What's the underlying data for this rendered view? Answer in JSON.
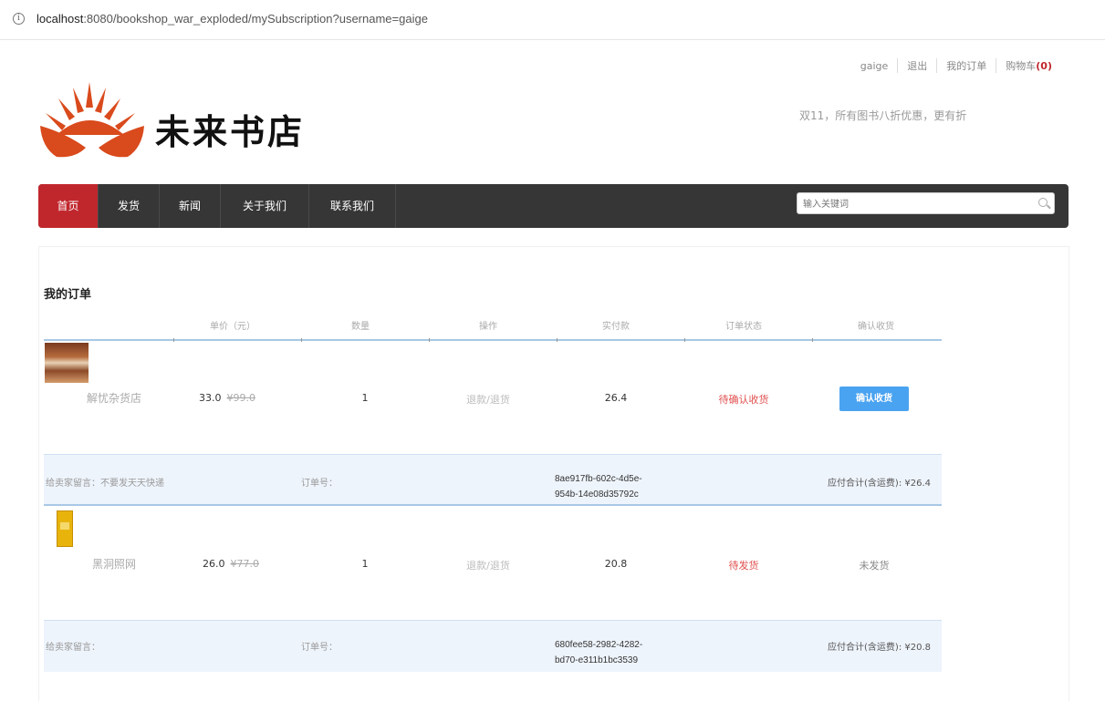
{
  "browser": {
    "url_host": "localhost",
    "url_rest": ":8080/bookshop_war_exploded/mySubscription?username=gaige"
  },
  "header": {
    "user_links": [
      "gaige",
      "退出",
      "我的订单",
      "购物车"
    ],
    "cart_count": "(0)",
    "promo": "双11，所有图书八折优惠，更有折",
    "logo_text": "未来书店"
  },
  "nav": {
    "items": [
      "首页",
      "发货",
      "新闻",
      "关于我们",
      "联系我们"
    ],
    "search_placeholder": "输入关键词"
  },
  "orders": {
    "title": "我的订单",
    "columns": [
      "单价（元）",
      "数量",
      "操作",
      "实付款",
      "订单状态",
      "确认收货"
    ],
    "rows": [
      {
        "name": "解忧杂货店",
        "price": "33.0",
        "old_price": "¥99.0",
        "qty": "1",
        "action": "退款/退货",
        "paid": "26.4",
        "status": "待确认收货",
        "confirm": "确认收货",
        "remark": "给卖家留言：不要发天天快递",
        "order_label": "订单号：",
        "order_id_1": "8ae917fb-602c-4d5e-",
        "order_id_2": "954b-14e08d35792c",
        "total": "应付合计(含运费): ¥26.4"
      },
      {
        "name": "黑洞照网",
        "price": "26.0",
        "old_price": "¥77.0",
        "qty": "1",
        "action": "退款/退货",
        "paid": "20.8",
        "status": "待发货",
        "confirm": "未发货",
        "remark": "给卖家留言：",
        "order_label": "订单号：",
        "order_id_1": "680fee58-2982-4282-",
        "order_id_2": "bd70-e311b1bc3539",
        "total": "应付合计(含运费): ¥20.8"
      }
    ]
  }
}
